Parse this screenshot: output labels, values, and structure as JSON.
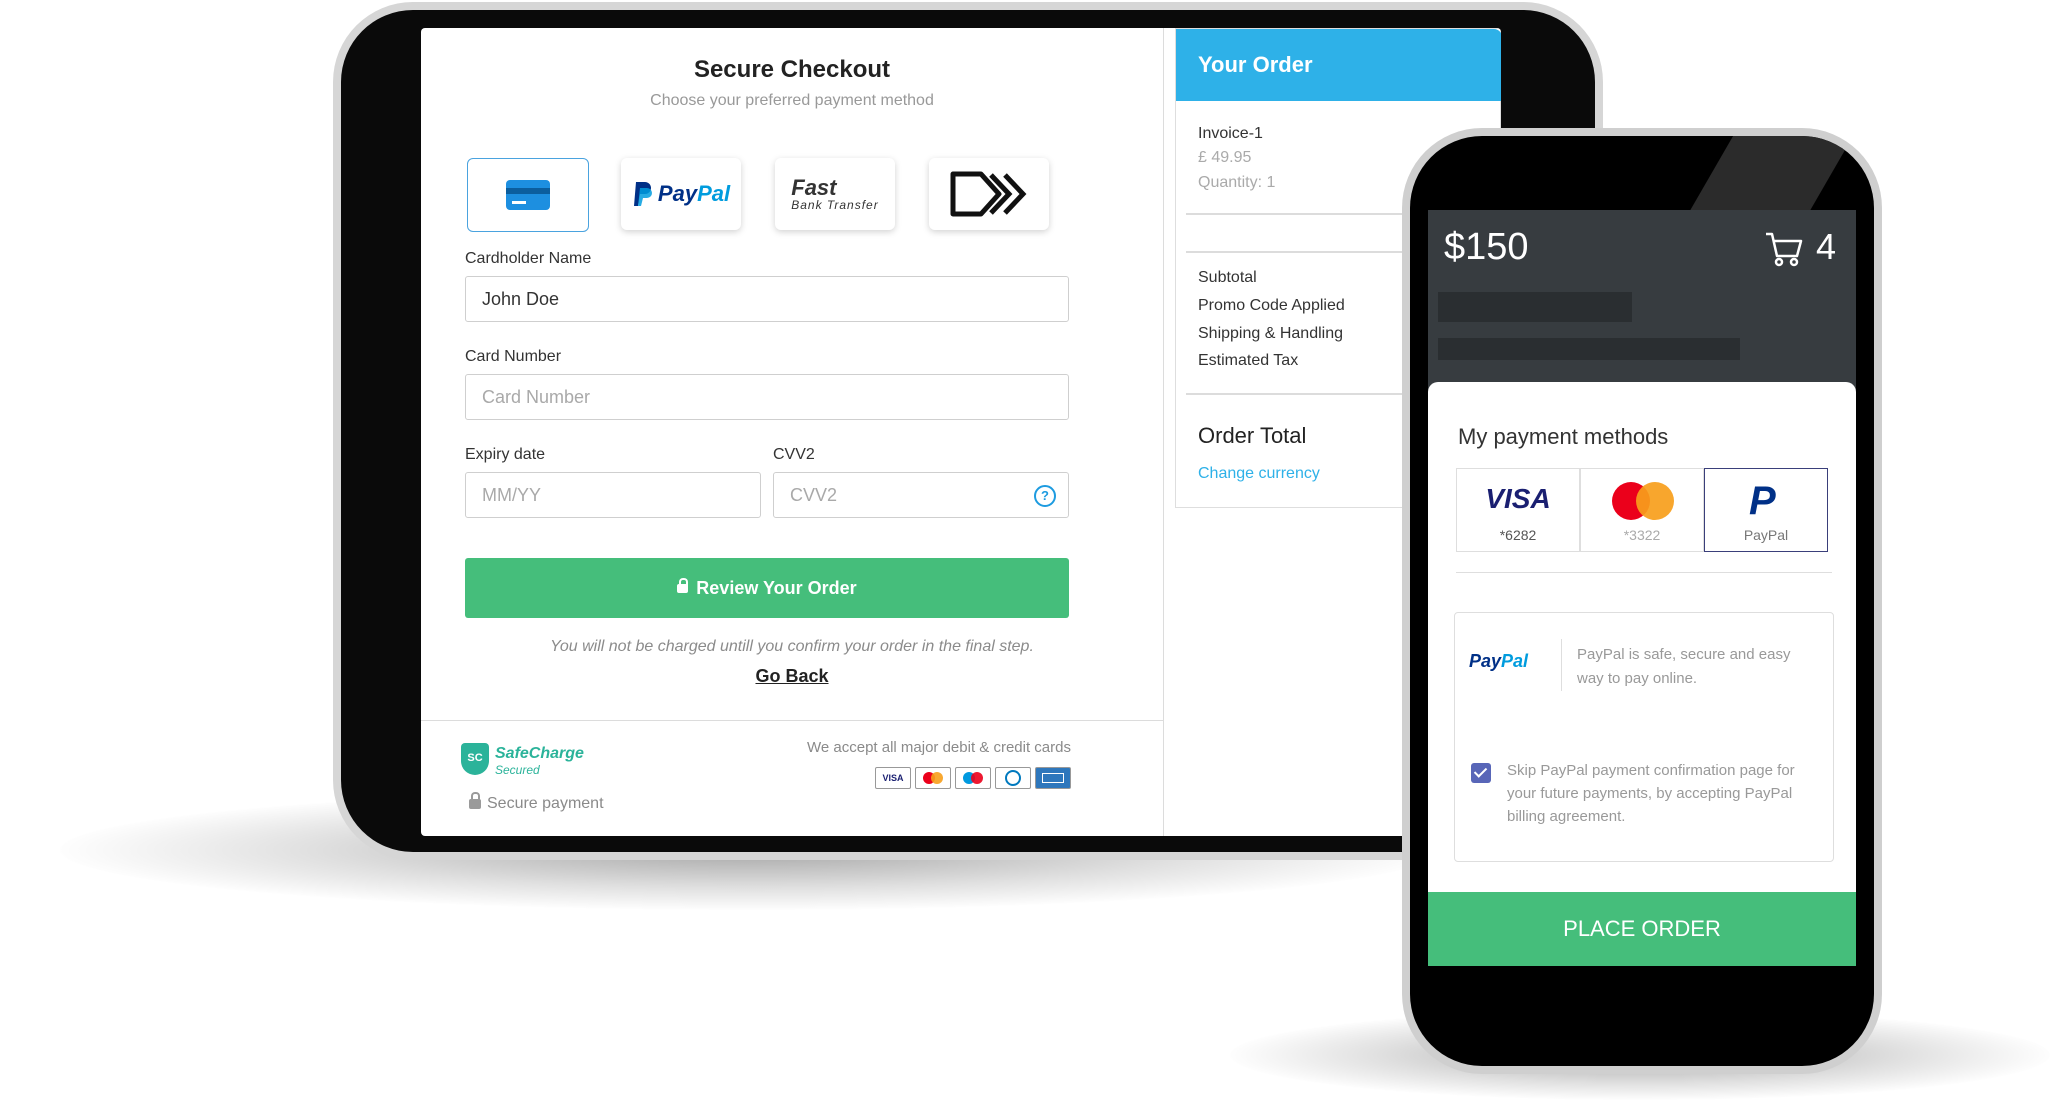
{
  "checkout": {
    "title": "Secure Checkout",
    "subtitle": "Choose your preferred payment method",
    "methods": {
      "paypal_a": "Pay",
      "paypal_b": "Pal",
      "fast_a": "Fast",
      "fast_b": "Bank Transfer"
    },
    "cardholder_label": "Cardholder Name",
    "cardholder_value": "John Doe",
    "card_number_label": "Card Number",
    "card_number_placeholder": "Card Number",
    "expiry_label": "Expiry date",
    "expiry_placeholder": "MM/YY",
    "cvv_label": "CVV2",
    "cvv_placeholder": "CVV2",
    "review_button": "Review Your Order",
    "note": "You will not be charged untill you confirm your order in the final step.",
    "go_back": "Go Back",
    "footer": {
      "brand_name": "SafeCharge",
      "brand_sub": "Secured",
      "brand_badge": "SC",
      "secure_payment": "Secure payment",
      "accept_text": "We accept all major debit & credit cards",
      "visa_mini": "VISA"
    }
  },
  "order": {
    "header": "Your Order",
    "item_name": "Invoice-1",
    "item_price": "£ 49.95",
    "item_qty": "Quantity: 1",
    "subtotal": "Subtotal",
    "promo": "Promo Code Applied",
    "shipping": "Shipping & Handling",
    "tax": "Estimated Tax",
    "total_label": "Order Total",
    "change_currency": "Change currency"
  },
  "phone": {
    "total": "$150",
    "cart_count": "4",
    "payment_title": "My payment methods",
    "cards": [
      {
        "brand": "VISA",
        "sub": "*6282"
      },
      {
        "brand": "mastercard",
        "sub": "*3322"
      },
      {
        "brand": "P",
        "sub": "PayPal"
      }
    ],
    "paypal_a": "Pay",
    "paypal_b": "Pal",
    "paypal_desc": "PayPal is safe, secure and easy way to pay online.",
    "skip_text": "Skip PayPal payment confirmation page for your future payments, by accepting PayPal billing agreement.",
    "place_order": "PLACE ORDER"
  },
  "colors": {
    "accent_blue": "#2eb1e8",
    "green": "#45be7b",
    "paypal_navy": "#003087",
    "paypal_blue": "#009cde"
  }
}
